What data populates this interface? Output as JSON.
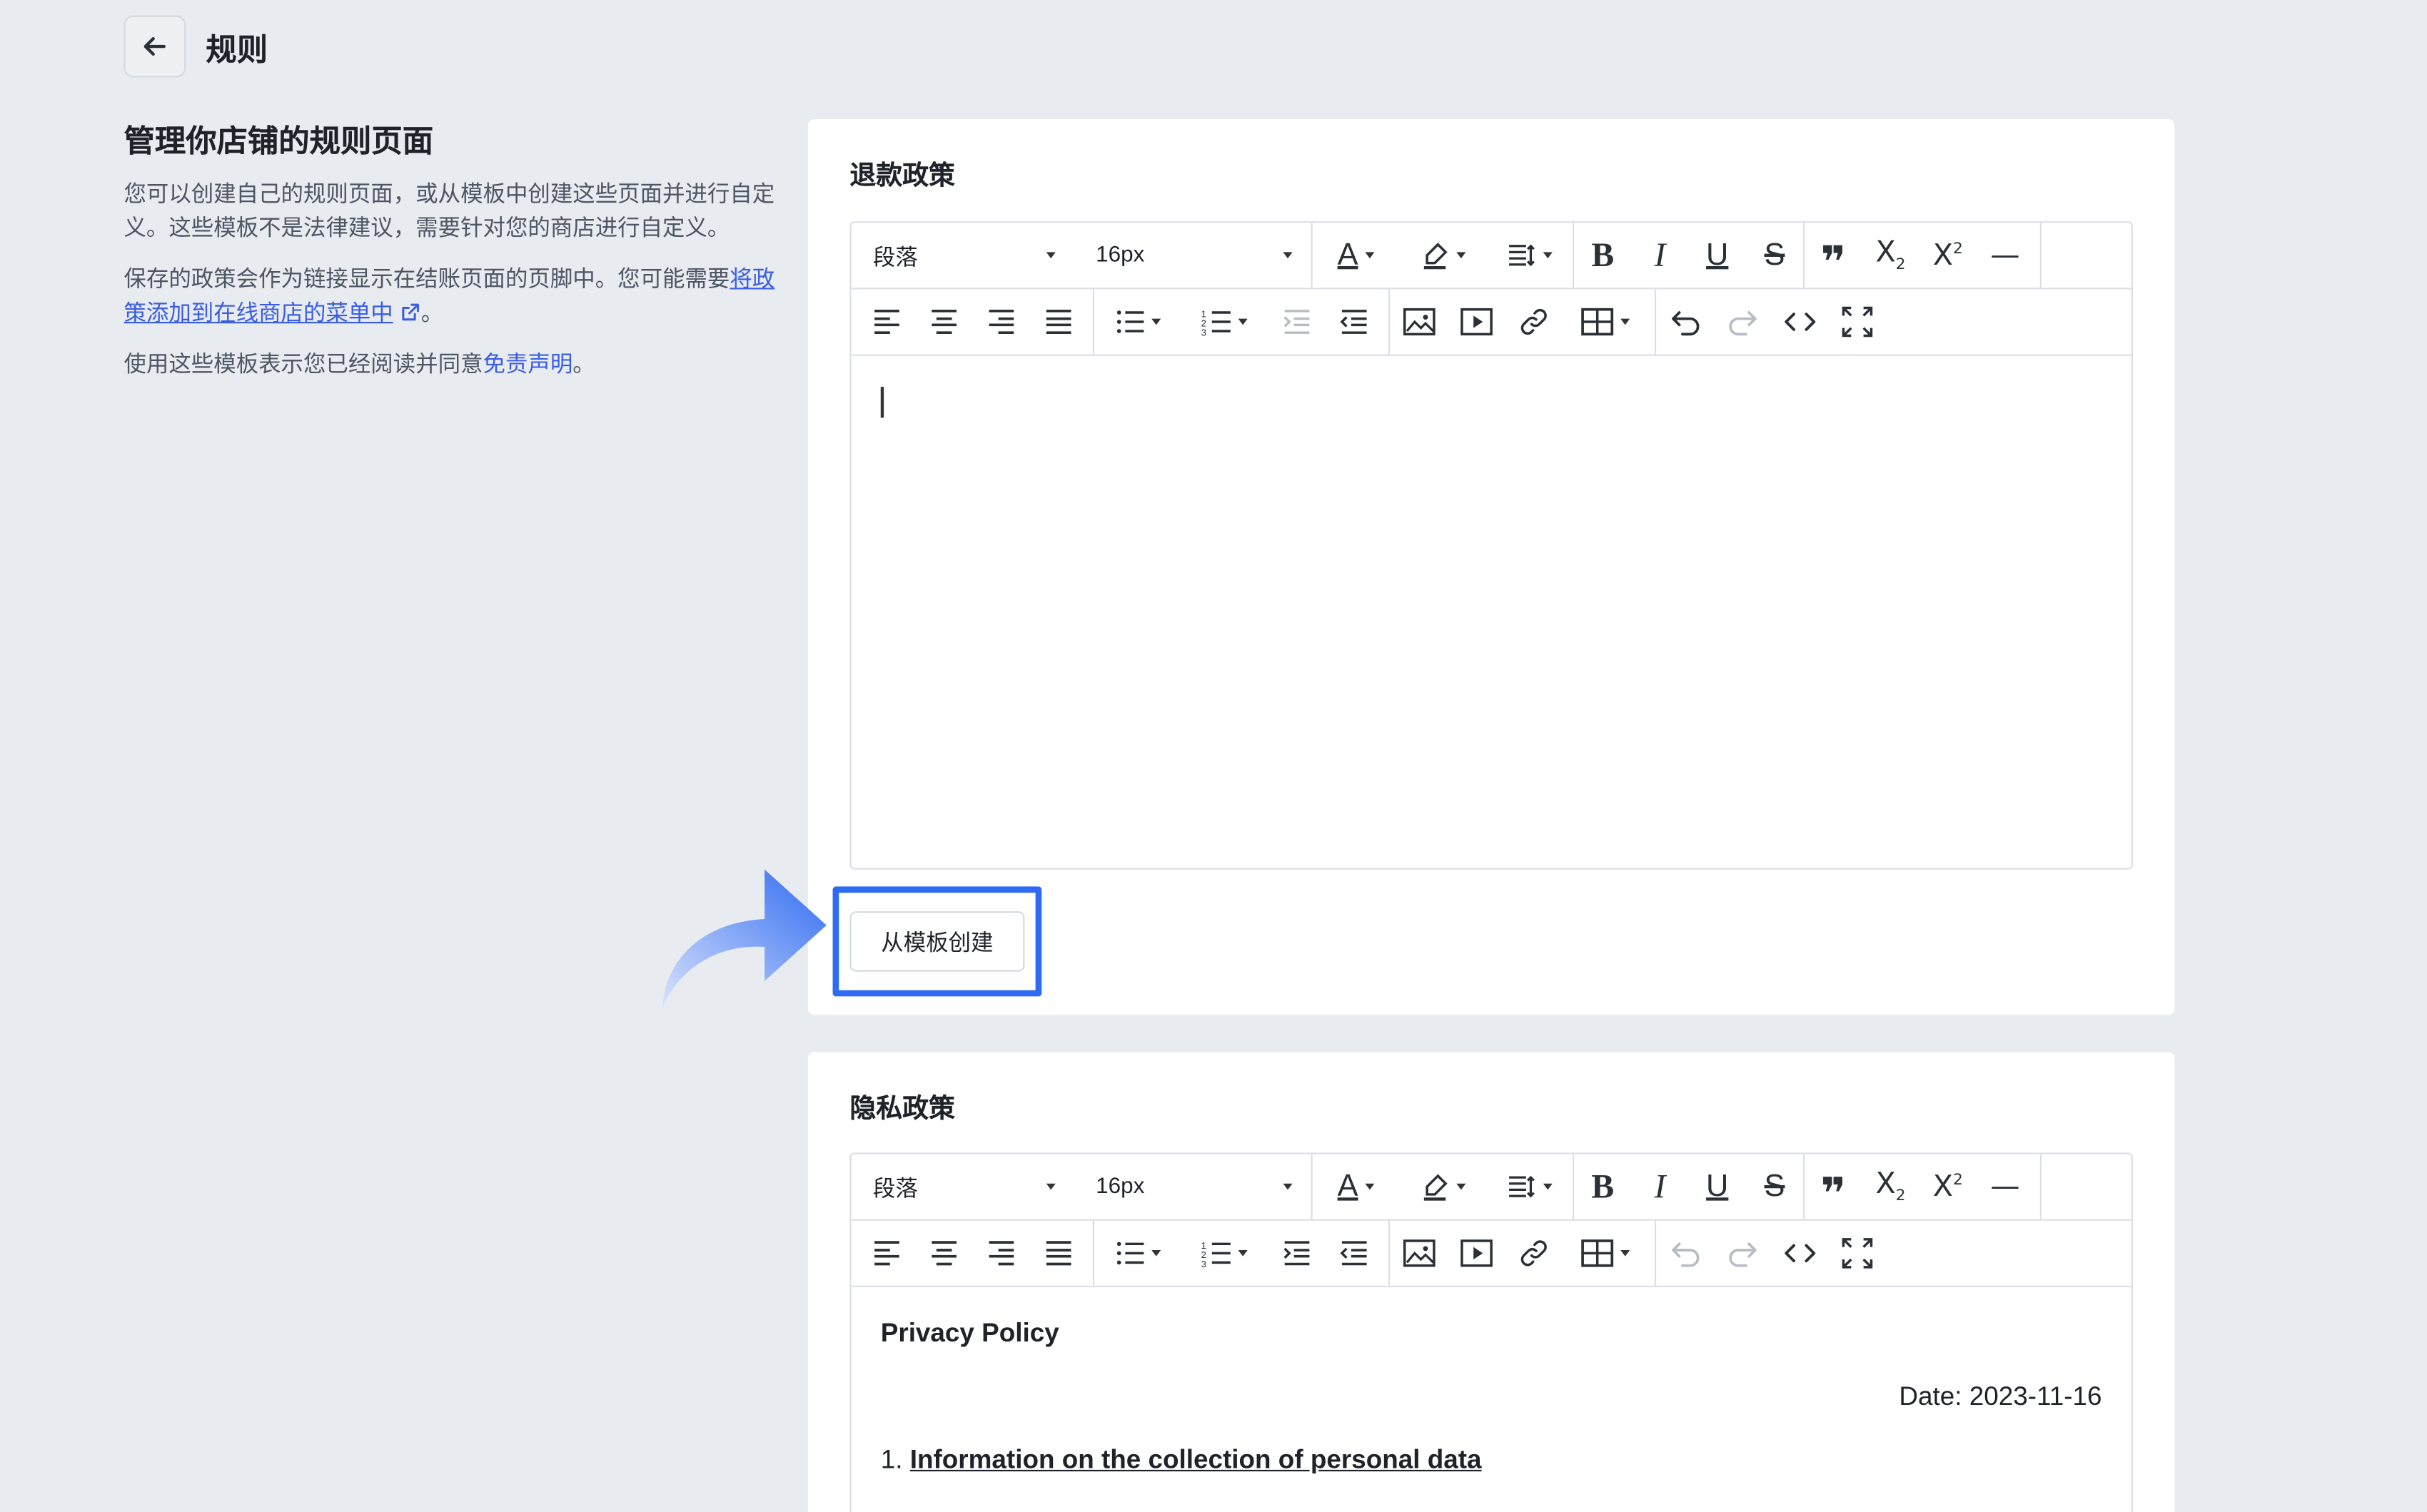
{
  "header": {
    "title": "规则"
  },
  "intro": {
    "heading": "管理你店铺的规则页面",
    "para1": "您可以创建自己的规则页面，或从模板中创建这些页面并进行自定义。这些模板不是法律建议，需要针对您的商店进行自定义。",
    "para2_prefix": "保存的政策会作为链接显示在结账页面的页脚中。您可能需要",
    "para2_link": "将政策添加到在线商店的菜单中",
    "para2_suffix": "。",
    "para3_prefix": "使用这些模板表示您已经阅读并同意",
    "para3_link": "免责声明",
    "para3_suffix": "。"
  },
  "toolbar": {
    "paragraph_select": "段落",
    "font_size_select": "16px",
    "icons": [
      "font-color-icon",
      "highlight-icon",
      "line-height-icon",
      "bold-icon",
      "italic-icon",
      "underline-icon",
      "strikethrough-icon",
      "quote-icon",
      "subscript-icon",
      "superscript-icon",
      "horizontal-rule-icon",
      "align-left-icon",
      "align-center-icon",
      "align-right-icon",
      "align-justify-icon",
      "bullet-list-icon",
      "numbered-list-icon",
      "indent-icon",
      "outdent-icon",
      "image-icon",
      "video-icon",
      "link-icon",
      "table-icon",
      "undo-icon",
      "redo-icon",
      "code-view-icon",
      "fullscreen-icon"
    ]
  },
  "refund": {
    "title": "退款政策",
    "template_button": "从模板创建"
  },
  "privacy": {
    "title": "隐私政策",
    "doc_title": "Privacy Policy",
    "doc_date": "Date: 2023-11-16",
    "section1_num": "1. ",
    "section1_title": "Information on the collection of personal data"
  },
  "colors": {
    "accent": "#2f6bf2",
    "link": "#3a5ee3",
    "background": "#e8ebf0"
  }
}
